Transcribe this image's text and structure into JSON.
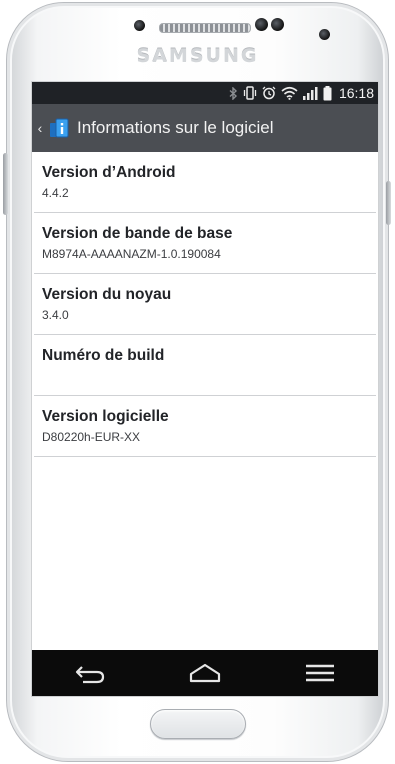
{
  "device": {
    "brand": "SAMSUNG"
  },
  "statusbar": {
    "time": "16:18",
    "icons": [
      "bluetooth-icon",
      "vibrate-icon",
      "alarm-icon",
      "wifi-icon",
      "signal-icon",
      "battery-icon"
    ]
  },
  "actionbar": {
    "title": "Informations sur le logiciel",
    "app_icon": "settings-app-icon"
  },
  "items": [
    {
      "title": "Version d’Android",
      "value": "4.4.2"
    },
    {
      "title": "Version de bande de base",
      "value": "M8974A-AAAANAZM-1.0.190084"
    },
    {
      "title": "Version du noyau",
      "value": "3.4.0"
    },
    {
      "title": "Numéro de build",
      "value": ""
    },
    {
      "title": "Version logicielle",
      "value": "D80220h-EUR-XX"
    }
  ],
  "navbar": {
    "buttons": [
      "back-icon",
      "home-icon",
      "menu-icon"
    ]
  },
  "colors": {
    "statusbar_bg": "#1f2226",
    "actionbar_bg": "#4b4e53",
    "navbar_bg": "#0b0b0b",
    "divider": "#cfd1d4",
    "accent_icon": "#2f8fe0"
  }
}
